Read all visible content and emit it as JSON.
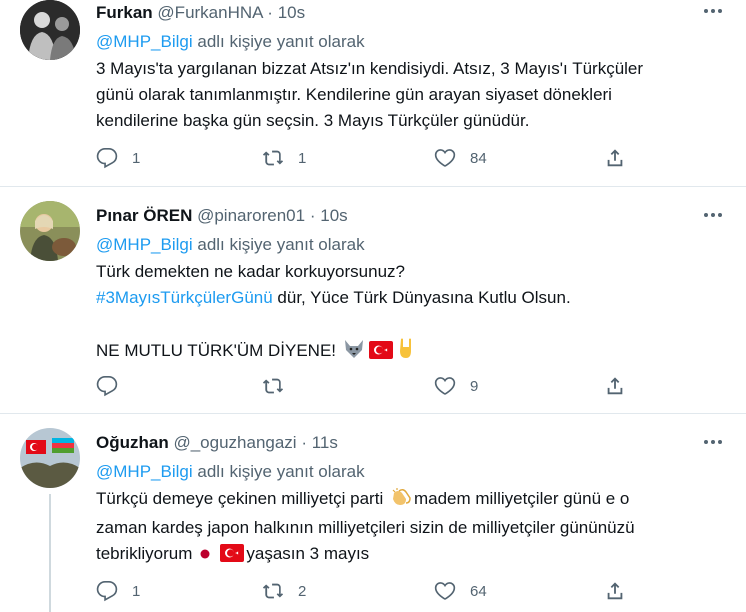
{
  "tweets": [
    {
      "name": "Furkan",
      "handle": "@FurkanHNA",
      "dot": "·",
      "time": "10s",
      "reply_prefix": "@MHP_Bilgi",
      "reply_suffix": "adlı kişiye yanıt olarak",
      "lines": [
        "3 Mayıs'ta yargılanan bizzat Atsız'ın kendisiydi. Atsız, 3 Mayıs'ı Türkçüler",
        "günü olarak tanımlanmıştır. Kendilerine gün arayan siyaset dönekleri",
        "kendilerine başka gün seçsin. 3 Mayıs Türkçüler günüdür."
      ],
      "replies": "1",
      "retweets": "1",
      "likes": "84"
    },
    {
      "name": "Pınar ÖREN",
      "handle": "@pinaroren01",
      "dot": "·",
      "time": "10s",
      "reply_prefix": "@MHP_Bilgi",
      "reply_suffix": "adlı kişiye yanıt olarak",
      "line1": "Türk demekten ne kadar korkuyorsunuz?",
      "hashtag": "#3MayısTürkçülerGünü",
      "line2_rest": " dür, Yüce Türk Dünyasına Kutlu Olsun.",
      "line3": "NE MUTLU TÜRK'ÜM DİYENE!",
      "replies": "",
      "retweets": "",
      "likes": "9"
    },
    {
      "name": "Oğuzhan",
      "handle": "@_oguzhangazi",
      "dot": "·",
      "time": "11s",
      "reply_prefix": "@MHP_Bilgi",
      "reply_suffix": "adlı kişiye yanıt olarak",
      "line1a": "Türkçü demeye çekinen milliyetçi parti ",
      "line1b": "madem milliyetçiler günü e o",
      "line2": "zaman  kardeş japon  halkının milliyetçileri sizin de milliyetçiler gününüzü",
      "line3a": "tebrikliyorum",
      "line3b": "yaşasın 3 mayıs",
      "replies": "1",
      "retweets": "2",
      "likes": "64"
    }
  ],
  "icons": {
    "reply": "reply-icon",
    "retweet": "retweet-icon",
    "like": "like-icon",
    "share": "share-icon",
    "more": "more-icon"
  },
  "colors": {
    "link": "#1d9bf0",
    "muted": "#536471",
    "text": "#0f1419",
    "divider": "#e1e8ed"
  }
}
